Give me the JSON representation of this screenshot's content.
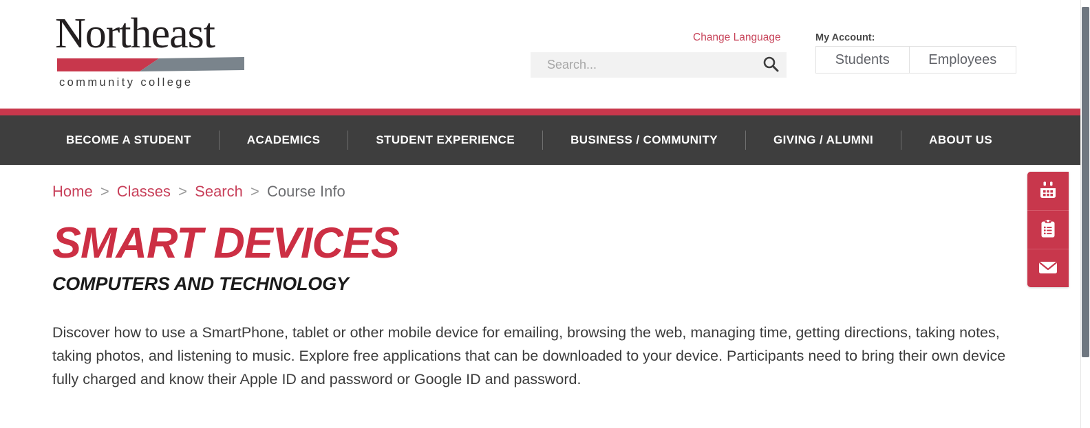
{
  "header": {
    "logo": {
      "word": "Northeast",
      "subtitle": "community college",
      "swoosh_red": "#c8374c",
      "swoosh_gray": "#7a848c"
    },
    "change_language": "Change Language",
    "search": {
      "placeholder": "Search...",
      "value": "",
      "icon": "search-icon"
    },
    "my_account": {
      "label": "My Account:",
      "tabs": [
        "Students",
        "Employees"
      ]
    }
  },
  "nav": {
    "items": [
      "BECOME A STUDENT",
      "ACADEMICS",
      "STUDENT EXPERIENCE",
      "BUSINESS / COMMUNITY",
      "GIVING / ALUMNI",
      "ABOUT US"
    ],
    "background": "#3e3e3e",
    "accent_rule": "#c8374c"
  },
  "breadcrumb": {
    "links": [
      "Home",
      "Classes",
      "Search"
    ],
    "current": "Course Info",
    "separator": ">"
  },
  "main": {
    "title": "SMART DEVICES",
    "subtitle": "COMPUTERS AND TECHNOLOGY",
    "body": "Discover how to use a SmartPhone, tablet or other mobile device for emailing, browsing the web, managing time, getting directions, taking notes, taking photos, and listening to music. Explore free applications that can be downloaded to your device. Participants need to bring their own device fully charged and know their Apple ID and password or Google ID and password.",
    "title_color": "#cc2f44"
  },
  "side_rail": {
    "background": "#c8374c",
    "buttons": [
      {
        "icon": "calendar-icon",
        "name": "calendar"
      },
      {
        "icon": "clipboard-list-icon",
        "name": "request-info"
      },
      {
        "icon": "envelope-icon",
        "name": "contact"
      }
    ]
  }
}
